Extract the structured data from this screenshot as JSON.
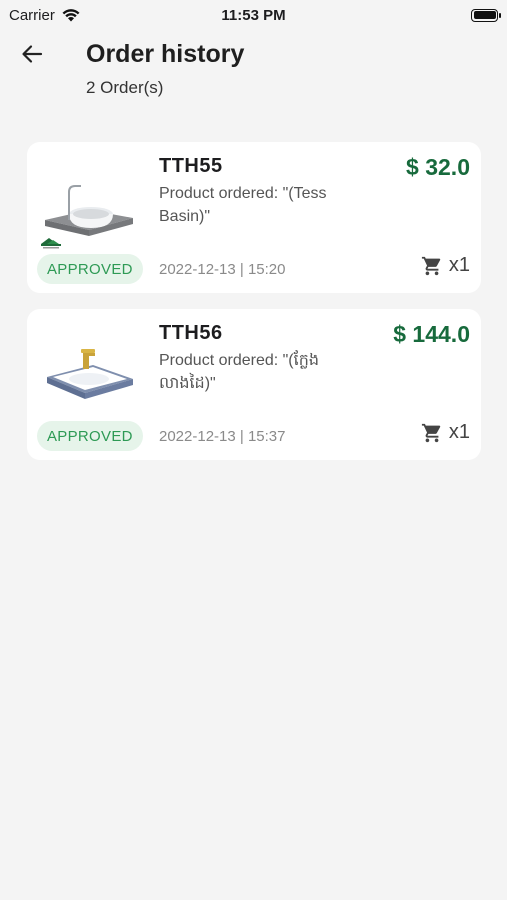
{
  "status_bar": {
    "carrier": "Carrier",
    "time": "11:53 PM"
  },
  "header": {
    "title": "Order history",
    "count": "2 Order(s)"
  },
  "orders": [
    {
      "code": "TTH55",
      "price": "$ 32.0",
      "product": "Product ordered: \"(Tess Basin)\"",
      "status": "APPROVED",
      "date": "2022-12-13 | 15:20",
      "quantity": "x1"
    },
    {
      "code": "TTH56",
      "price": "$ 144.0",
      "product": "Product ordered: \"(ក្លែង លាងដៃ)\"",
      "status": "APPROVED",
      "date": "2022-12-13 | 15:37",
      "quantity": "x1"
    }
  ],
  "icons": {
    "back": "arrow-left-icon",
    "cart": "cart-icon",
    "wifi": "wifi-icon",
    "battery": "battery-icon"
  },
  "colors": {
    "price": "#176a3c",
    "badge_bg": "#e6f4ea",
    "badge_text": "#2e9a55"
  }
}
